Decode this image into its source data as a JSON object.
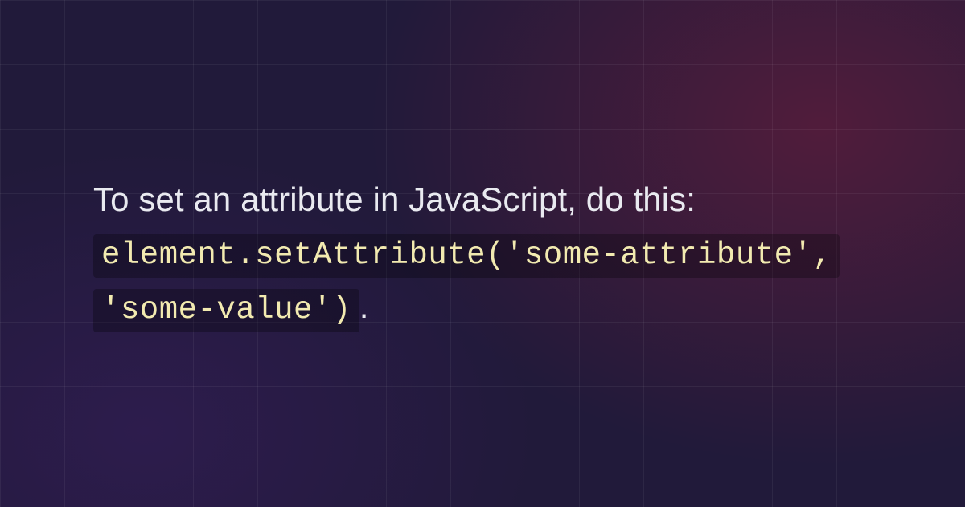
{
  "text": {
    "lead": "To set an attribute in JavaScript, do this: ",
    "code": "element.setAttribute('some-attribute', 'some-value')",
    "trail": "."
  }
}
